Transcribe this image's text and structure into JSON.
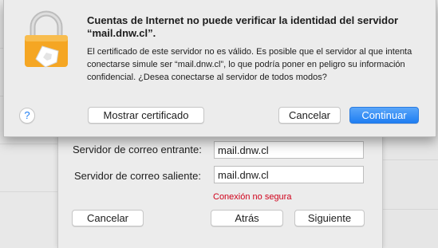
{
  "alert": {
    "title": "Cuentas de Internet no puede verificar la identidad del servidor “mail.dnw.cl”.",
    "body": "El certificado de este servidor no es válido. Es posible que el servidor al que intenta conectarse simule ser “mail.dnw.cl”, lo que podría poner en peligro su información confidencial. ¿Desea conectarse al servidor de todos modos?",
    "help_label": "?",
    "show_certificate_label": "Mostrar certificado",
    "cancel_label": "Cancelar",
    "continue_label": "Continuar",
    "icon": "lock-icon"
  },
  "account": {
    "incoming_label": "Servidor de correo entrante:",
    "incoming_value": "mail.dnw.cl",
    "outgoing_label": "Servidor de correo saliente:",
    "outgoing_value": "mail.dnw.cl",
    "warning": "Conexión no segura",
    "cancel_label": "Cancelar",
    "back_label": "Atrás",
    "next_label": "Siguiente"
  },
  "colors": {
    "accent": "#1f7ef2",
    "warning": "#d0021b",
    "lock_body": "#f5a623",
    "lock_shackle": "#c8c8c8"
  }
}
